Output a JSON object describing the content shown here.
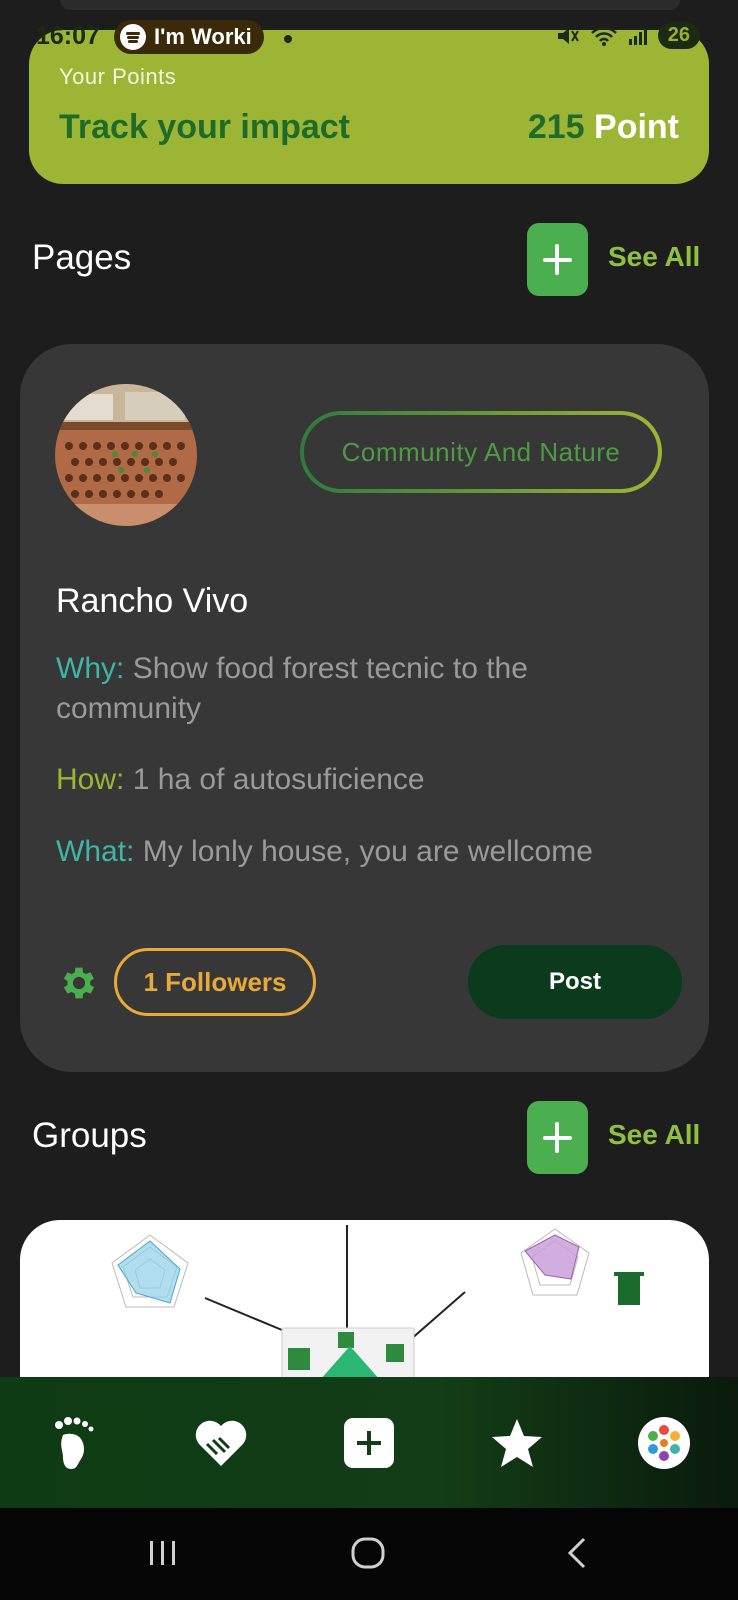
{
  "status_bar": {
    "time": "16:07",
    "media_label": "I'm Worki",
    "battery": "26"
  },
  "points": {
    "label": "Your Points",
    "title": "Track your impact",
    "value": "215",
    "unit": "Point"
  },
  "pages_section": {
    "title": "Pages",
    "see_all": "See All"
  },
  "page_card": {
    "category": "Community And Nature",
    "name": "Rancho Vivo",
    "why_key": "Why:",
    "why_text": "Show food forest tecnic to the community",
    "how_key": "How:",
    "how_text": "1 ha of autosuficience",
    "what_key": "What:",
    "what_text": "My lonly house, you are wellcome",
    "followers": "1 Followers",
    "post": "Post"
  },
  "groups_section": {
    "title": "Groups",
    "see_all": "See All"
  },
  "nav": [
    "footprint-icon",
    "heart-handshake-icon",
    "add-square-icon",
    "star-icon",
    "profile-avatar"
  ],
  "colors": {
    "accent": "#9db535",
    "green": "#4caf4f",
    "card": "#363736",
    "background": "#1c1d1c"
  }
}
